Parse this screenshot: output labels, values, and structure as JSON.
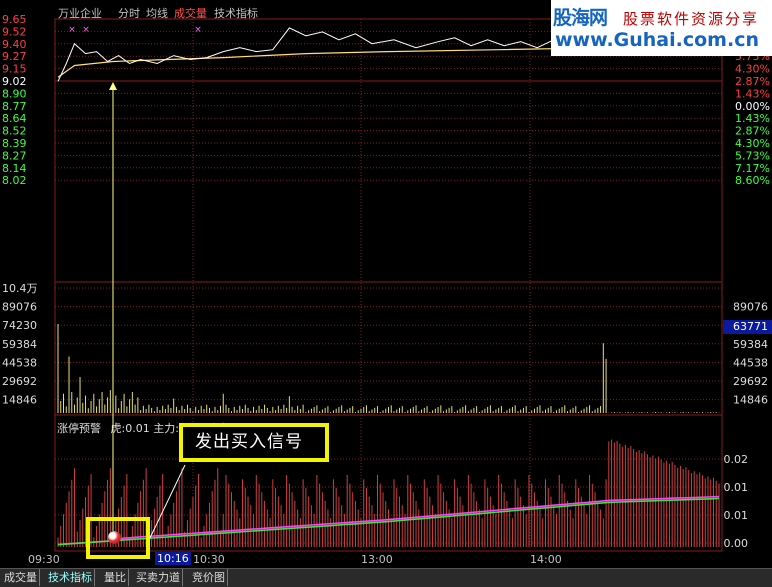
{
  "toolbar": {
    "stock_name": "万业企业",
    "items": [
      "分时",
      "均线",
      "成交量",
      "技术指标"
    ],
    "item_colors": [
      "#ffffff",
      "#ffffff",
      "#ff5050",
      "#ffffff"
    ]
  },
  "brand": {
    "site_name": "股海网",
    "slogan": "股票软件资源分享",
    "url": "www.Guhai.com.cn"
  },
  "price_axis": {
    "left_labels": [
      "9.65",
      "9.52",
      "9.40",
      "9.27",
      "9.15",
      "9.02",
      "8.90",
      "8.77",
      "8.64",
      "8.52",
      "8.39",
      "8.27",
      "8.14",
      "8.02"
    ],
    "right_labels": [
      "7.17%",
      "5.73%",
      "4.30%",
      "2.87%",
      "1.43%",
      "0.00%",
      "1.43%",
      "2.87%",
      "4.30%",
      "5.73%",
      "7.17%",
      "8.60%"
    ],
    "up_color": "#ff4040",
    "flat_color": "#ffffff",
    "down_color": "#40ff40"
  },
  "volume_axis": {
    "left_labels": [
      "10.4万",
      "89076",
      "74230",
      "59384",
      "44538",
      "29692",
      "14846"
    ],
    "right_labels": [
      "89076",
      "74230",
      "59384",
      "44538",
      "29692",
      "14846"
    ],
    "cursor_value": "63771"
  },
  "indicator": {
    "label": "涨停预警",
    "params": "虎:0.01  主力:0.01  散户:0.01",
    "right_labels": [
      "0.02",
      "0.01",
      "0.01",
      "0.00"
    ]
  },
  "callout": {
    "text": "发出买入信号"
  },
  "time_axis": {
    "labels": [
      "09:30",
      "10:16",
      "10:30",
      "13:00",
      "14:00"
    ],
    "cursor_label": "10:16"
  },
  "tabs": [
    "成交量",
    "技术指标",
    "量比",
    "买卖力道",
    "竞价图"
  ],
  "chart_data": {
    "type": "line",
    "price_series": [
      {
        "t": 0,
        "price": 9.02
      },
      {
        "t": 3,
        "price": 9.2
      },
      {
        "t": 6,
        "price": 9.4
      },
      {
        "t": 10,
        "price": 9.3
      },
      {
        "t": 14,
        "price": 9.32
      },
      {
        "t": 18,
        "price": 9.22
      },
      {
        "t": 22,
        "price": 9.28
      },
      {
        "t": 26,
        "price": 9.2
      },
      {
        "t": 30,
        "price": 9.24
      },
      {
        "t": 36,
        "price": 9.2
      },
      {
        "t": 42,
        "price": 9.28
      },
      {
        "t": 48,
        "price": 9.24
      },
      {
        "t": 54,
        "price": 9.26
      },
      {
        "t": 60,
        "price": 9.32
      },
      {
        "t": 66,
        "price": 9.36
      },
      {
        "t": 72,
        "price": 9.32
      },
      {
        "t": 78,
        "price": 9.34
      },
      {
        "t": 84,
        "price": 9.56
      },
      {
        "t": 90,
        "price": 9.48
      },
      {
        "t": 96,
        "price": 9.52
      },
      {
        "t": 102,
        "price": 9.44
      },
      {
        "t": 108,
        "price": 9.5
      },
      {
        "t": 114,
        "price": 9.4
      },
      {
        "t": 122,
        "price": 9.44
      },
      {
        "t": 130,
        "price": 9.36
      },
      {
        "t": 138,
        "price": 9.42
      },
      {
        "t": 144,
        "price": 9.46
      },
      {
        "t": 150,
        "price": 9.38
      },
      {
        "t": 156,
        "price": 9.44
      },
      {
        "t": 162,
        "price": 9.38
      },
      {
        "t": 168,
        "price": 9.42
      },
      {
        "t": 174,
        "price": 9.36
      },
      {
        "t": 180,
        "price": 9.44
      },
      {
        "t": 186,
        "price": 9.48
      },
      {
        "t": 190,
        "price": 9.46
      },
      {
        "t": 196,
        "price": 9.48
      },
      {
        "t": 200,
        "price": 9.65
      },
      {
        "t": 240,
        "price": 9.65
      }
    ],
    "avg_series": [
      {
        "t": 0,
        "price": 9.06
      },
      {
        "t": 6,
        "price": 9.18
      },
      {
        "t": 20,
        "price": 9.22
      },
      {
        "t": 40,
        "price": 9.24
      },
      {
        "t": 60,
        "price": 9.26
      },
      {
        "t": 90,
        "price": 9.3
      },
      {
        "t": 120,
        "price": 9.32
      },
      {
        "t": 160,
        "price": 9.34
      },
      {
        "t": 200,
        "price": 9.36
      },
      {
        "t": 202,
        "price": 9.42
      },
      {
        "t": 240,
        "price": 9.43
      }
    ],
    "price_range": [
      8.02,
      9.65
    ],
    "volume_max": 104000,
    "volume_spikes": [
      {
        "t": 0,
        "v": 74000
      },
      {
        "t": 4,
        "v": 47000
      },
      {
        "t": 8,
        "v": 30000
      },
      {
        "t": 42,
        "v": 12000
      },
      {
        "t": 60,
        "v": 16000
      },
      {
        "t": 84,
        "v": 14000
      },
      {
        "t": 198,
        "v": 58000
      },
      {
        "t": 199,
        "v": 45000
      }
    ],
    "indicator_range": [
      0,
      0.025
    ],
    "indicator_series": [
      {
        "name": "虎",
        "color": "#ff40ff"
      },
      {
        "name": "主力",
        "color": "#40e040"
      }
    ],
    "time_labels": [
      "09:30",
      "10:30",
      "13:00",
      "14:00"
    ]
  }
}
